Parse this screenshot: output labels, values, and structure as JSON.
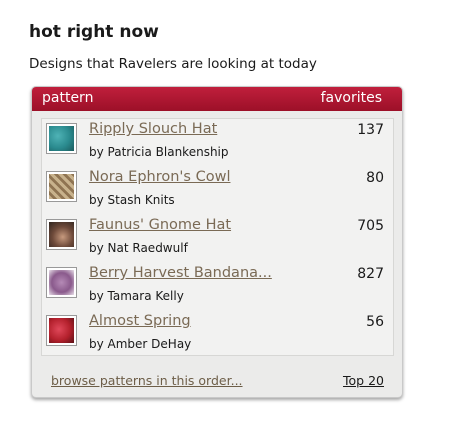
{
  "section": {
    "title": "hot right now",
    "subtitle": "Designs that Ravelers are looking at today"
  },
  "table": {
    "header_pattern": "pattern",
    "header_favorites": "favorites",
    "rows": [
      {
        "title": "Ripply Slouch Hat",
        "byline": "by Patricia Blankenship",
        "favorites": "137",
        "thumb_color": "#2a8a8e"
      },
      {
        "title": "Nora Ephron's Cowl",
        "byline": "by Stash Knits",
        "favorites": "80",
        "thumb_color": "#a9916c"
      },
      {
        "title": "Faunus' Gnome Hat",
        "byline": "by Nat Raedwulf",
        "favorites": "705",
        "thumb_color": "#6e4a3a"
      },
      {
        "title": "Berry Harvest Bandana...",
        "byline": "by Tamara Kelly",
        "favorites": "827",
        "thumb_color": "#8a5a8c"
      },
      {
        "title": "Almost Spring",
        "byline": "by Amber DeHay",
        "favorites": "56",
        "thumb_color": "#b3202c"
      }
    ]
  },
  "footer": {
    "browse_label": "browse patterns in this order...",
    "top_label": "Top 20"
  },
  "colors": {
    "header_red": "#ad1632",
    "link_brown": "#7a6a55"
  }
}
